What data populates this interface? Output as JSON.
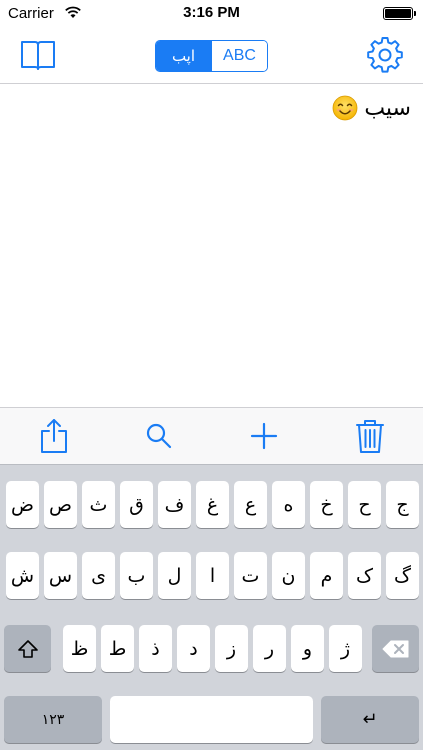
{
  "status_bar": {
    "carrier": "Carrier",
    "time": "3:16 PM",
    "battery_level": 1.0
  },
  "nav_bar": {
    "left_icon": "book-icon",
    "right_icon": "gear-icon",
    "segments": [
      {
        "label": "اپب",
        "selected": true
      },
      {
        "label": "ABC",
        "selected": false
      }
    ]
  },
  "text_area": {
    "text": "سیب",
    "emoji": "smiling-face-emoji"
  },
  "toolbar": {
    "icons": [
      "share-icon",
      "search-icon",
      "add-icon",
      "trash-icon"
    ]
  },
  "keyboard": {
    "row1": [
      "ج",
      "ح",
      "خ",
      "ه",
      "ع",
      "غ",
      "ف",
      "ق",
      "ث",
      "ص",
      "ض"
    ],
    "row2": [
      "گ",
      "ک",
      "م",
      "ن",
      "ت",
      "ا",
      "ل",
      "ب",
      "ی",
      "س",
      "ش"
    ],
    "row3": [
      "ژ",
      "و",
      "ر",
      "ز",
      "د",
      "ذ",
      "ط",
      "ظ"
    ],
    "numbers_label": "۱۲۳",
    "return_label": "↵",
    "space_label": ""
  },
  "colors": {
    "accent": "#1a7cf4",
    "keyboard_bg": "#d1d4da",
    "function_key": "#adb3bc"
  }
}
